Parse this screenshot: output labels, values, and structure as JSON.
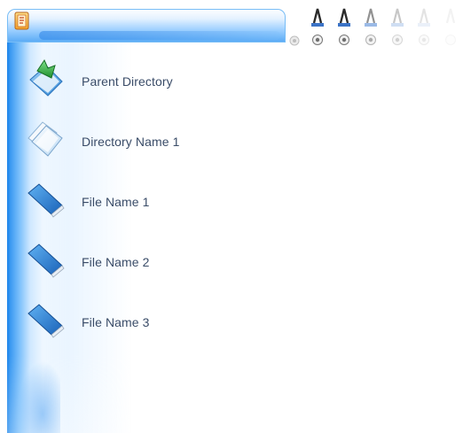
{
  "window": {
    "icon": "document-app-icon"
  },
  "toolbar": {
    "buttons": [
      {
        "name": "tool-button-1",
        "icon": "tool-icon"
      },
      {
        "name": "tool-button-2",
        "icon": "tool-icon"
      },
      {
        "name": "tool-button-3",
        "icon": "tool-icon"
      },
      {
        "name": "tool-button-4",
        "icon": "tool-icon"
      },
      {
        "name": "tool-button-5",
        "icon": "tool-icon"
      },
      {
        "name": "tool-button-6",
        "icon": "tool-icon"
      }
    ]
  },
  "file_list": {
    "items": [
      {
        "label": "Parent Directory",
        "icon": "parent-directory-icon"
      },
      {
        "label": "Directory Name 1",
        "icon": "folder-icon"
      },
      {
        "label": "File Name 1",
        "icon": "book-icon"
      },
      {
        "label": "File Name 2",
        "icon": "book-icon"
      },
      {
        "label": "File Name 3",
        "icon": "book-icon"
      }
    ]
  },
  "colors": {
    "accent_blue": "#2a8ef0",
    "text": "#3a4c68"
  }
}
